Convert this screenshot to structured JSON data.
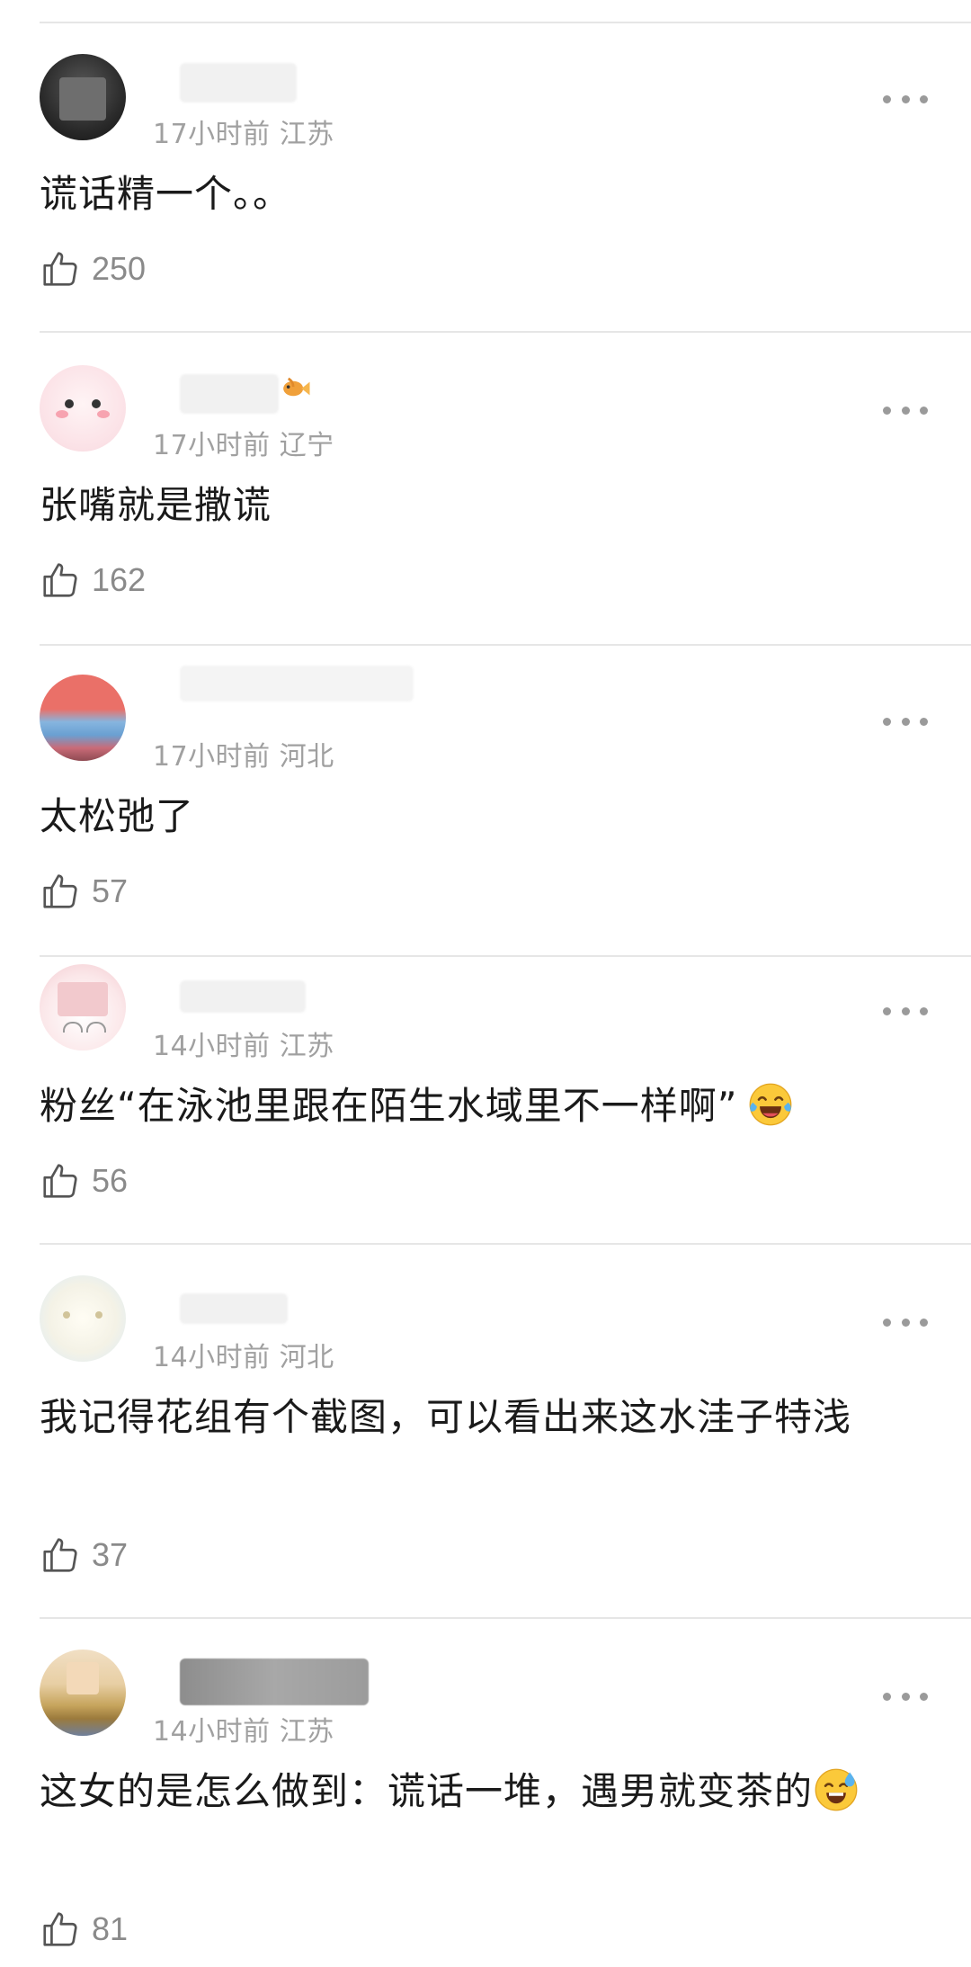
{
  "comments": [
    {
      "time": "17小时前",
      "location": "江苏",
      "text": "谎话精一个。。",
      "likes": "250",
      "avatar_colors": [
        "#3a3a3a",
        "#1f1f1f"
      ]
    },
    {
      "time": "17小时前",
      "location": "辽宁",
      "text": "张嘴就是撒谎",
      "likes": "162",
      "avatar_colors": [
        "#fbe3e8",
        "#f6cfd6"
      ]
    },
    {
      "time": "17小时前",
      "location": "河北",
      "text": "太松弛了",
      "likes": "57",
      "avatar_colors": [
        "#e8736a",
        "#7aa9d8"
      ]
    },
    {
      "time": "14小时前",
      "location": "江苏",
      "text": "粉丝“在泳池里跟在陌生水域里不一样啊”",
      "likes": "56",
      "avatar_colors": [
        "#f6d3d6",
        "#fbe9ea"
      ]
    },
    {
      "time": "14小时前",
      "location": "河北",
      "text": "我记得花组有个截图，可以看出来这水洼子特浅",
      "likes": "37",
      "avatar_colors": [
        "#eaf3fb",
        "#f6e9c8"
      ]
    },
    {
      "time": "14小时前",
      "location": "江苏",
      "text": "这女的是怎么做到：谎话一堆，遇男就变茶的",
      "likes": "81",
      "avatar_colors": [
        "#e9d6b8",
        "#b9a26a"
      ]
    }
  ]
}
